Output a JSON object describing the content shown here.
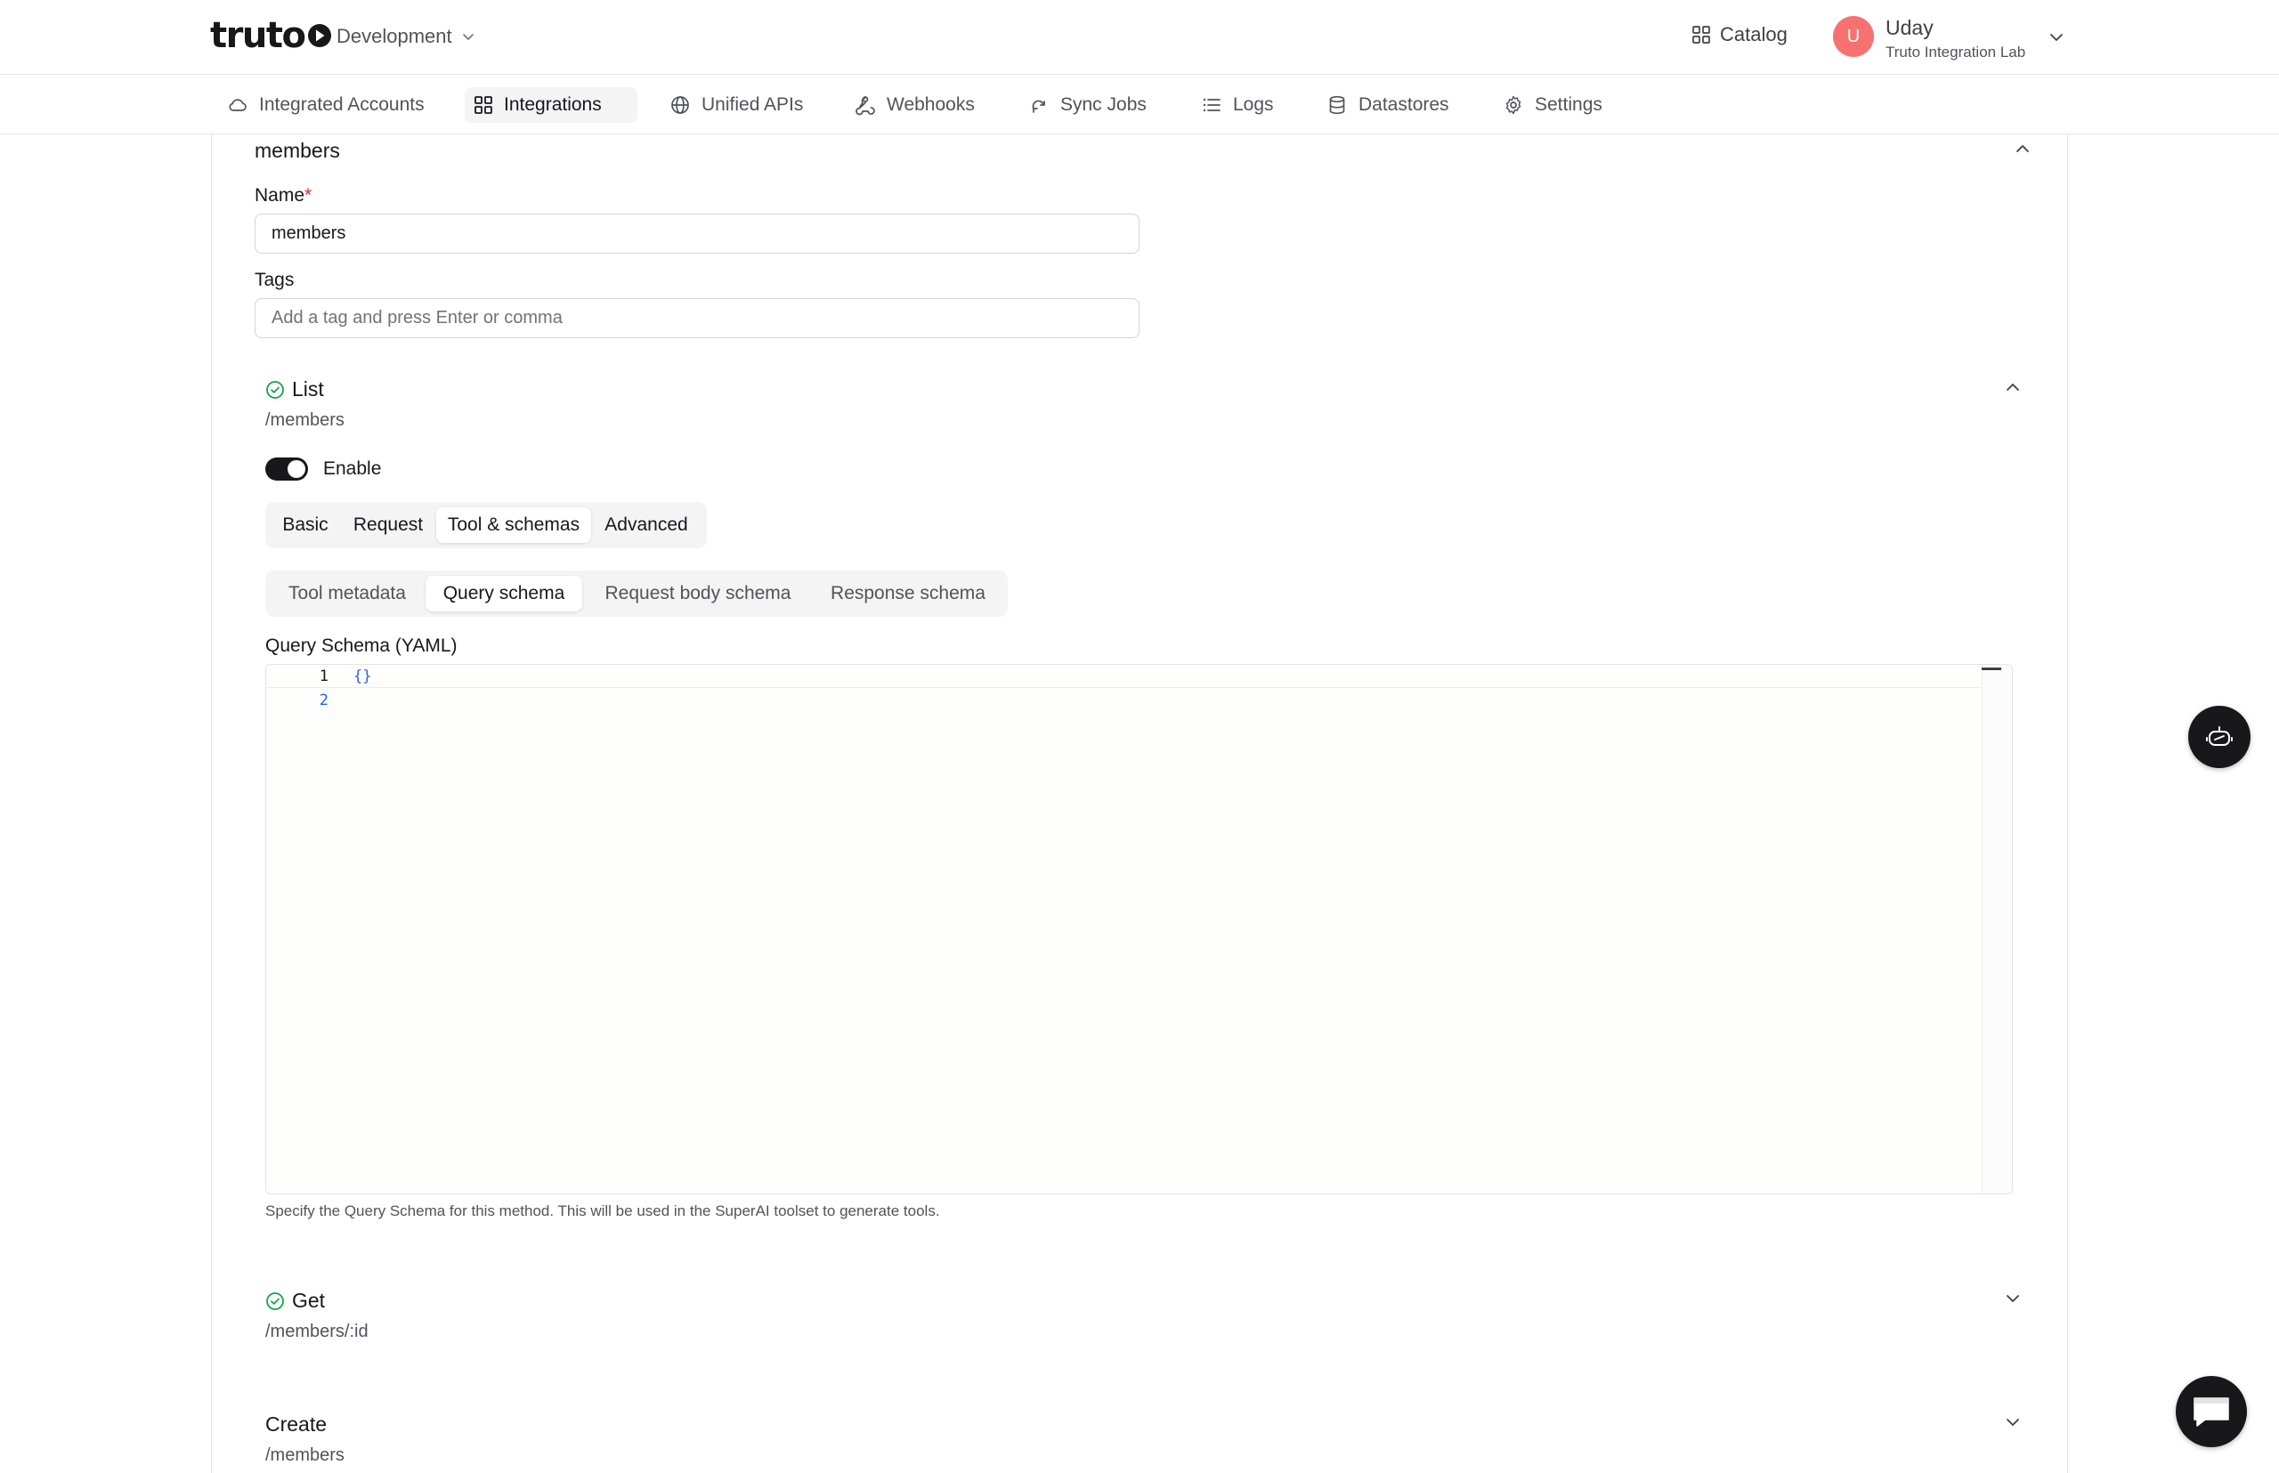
{
  "header": {
    "logo": "truto",
    "environment": "Development",
    "catalog_label": "Catalog",
    "user": {
      "initial": "U",
      "name": "Uday",
      "org": "Truto Integration Lab"
    }
  },
  "nav": {
    "items": [
      {
        "label": "Integrated Accounts",
        "icon": "cloud-icon"
      },
      {
        "label": "Integrations",
        "icon": "grid-icon",
        "active": true
      },
      {
        "label": "Unified APIs",
        "icon": "globe-icon"
      },
      {
        "label": "Webhooks",
        "icon": "webhook-icon"
      },
      {
        "label": "Sync Jobs",
        "icon": "sync-icon"
      },
      {
        "label": "Logs",
        "icon": "list-icon"
      },
      {
        "label": "Datastores",
        "icon": "database-icon"
      },
      {
        "label": "Settings",
        "icon": "gear-icon"
      }
    ]
  },
  "resource": {
    "title": "members",
    "name_label": "Name",
    "required_marker": "*",
    "name_value": "members",
    "tags_label": "Tags",
    "tags_placeholder": "Add a tag and press Enter or comma"
  },
  "list_method": {
    "title": "List",
    "path": "/members",
    "enable_label": "Enable",
    "tabs": [
      "Basic",
      "Request",
      "Tool & schemas",
      "Advanced"
    ],
    "active_tab": "Tool & schemas",
    "subtabs": [
      "Tool metadata",
      "Query schema",
      "Request body schema",
      "Response schema"
    ],
    "active_subtab": "Query schema",
    "editor_label": "Query Schema (YAML)",
    "editor_lines": [
      {
        "number": "1",
        "code": "{}"
      },
      {
        "number": "2",
        "code": ""
      }
    ],
    "help_text": "Specify the Query Schema for this method. This will be used in the SuperAI toolset to generate tools."
  },
  "get_method": {
    "title": "Get",
    "path": "/members/:id"
  },
  "create_method": {
    "title": "Create",
    "path": "/members"
  },
  "colors": {
    "accent": "#18181b",
    "success": "#16a34a",
    "required": "#dc2626",
    "avatar": "#f87171",
    "code": "#2563eb"
  }
}
